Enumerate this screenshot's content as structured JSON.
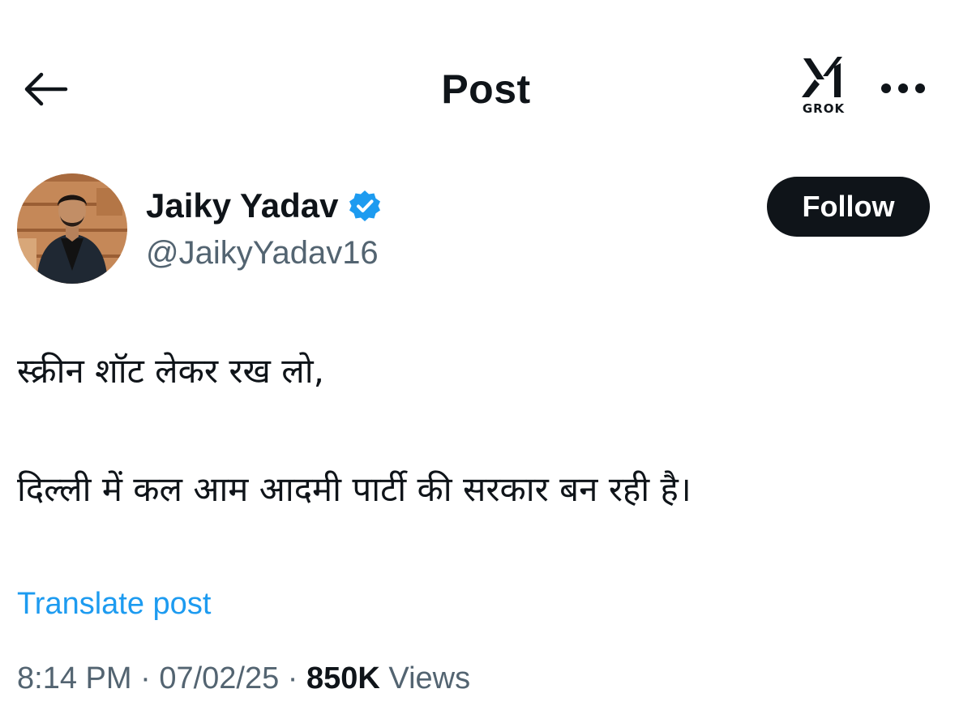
{
  "header": {
    "title": "Post",
    "back_icon": "arrow-left-icon",
    "grok_label": "GROK",
    "grok_icon": "grok-logo-icon",
    "more_icon": "ellipsis-icon"
  },
  "author": {
    "name": "Jaiky Yadav",
    "handle": "@JaikyYadav16",
    "verified": true,
    "verified_color": "#1d9bf0"
  },
  "follow_button": {
    "label": "Follow"
  },
  "post": {
    "lines": [
      "स्क्रीन शॉट लेकर रख लो,",
      "दिल्ली में कल आम आदमी पार्टी की सरकार बन रही है।"
    ]
  },
  "translate_label": "Translate post",
  "meta": {
    "time": "8:14 PM",
    "date": "07/02/25",
    "views_count": "850K",
    "views_label": "Views",
    "separator": "·"
  },
  "colors": {
    "text": "#0f1419",
    "secondary": "#536471",
    "link": "#1d9bf0",
    "button_bg": "#0f1419"
  }
}
